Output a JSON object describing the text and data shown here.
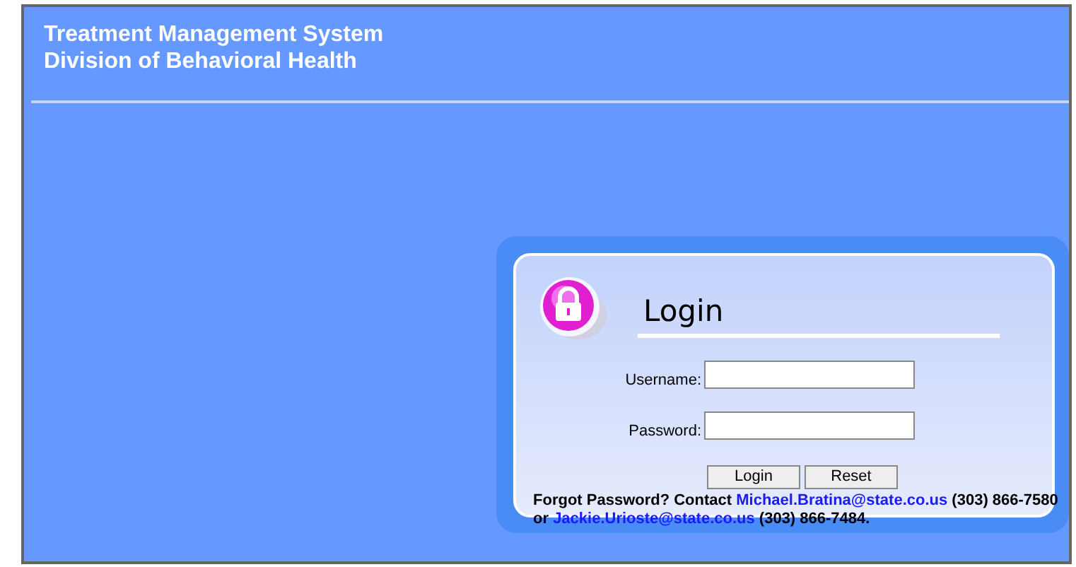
{
  "header": {
    "title": "Treatment Management System",
    "subtitle": "Division of Behavioral Health"
  },
  "login": {
    "title": "Login",
    "fields": [
      {
        "label": "Username:"
      },
      {
        "label": "Password:"
      }
    ],
    "buttons": [
      "Login",
      "Reset"
    ],
    "help": [
      {
        "kind": "text",
        "text": "Forgot Password? Contact "
      },
      {
        "kind": "link",
        "text": "Michael.Bratina@state.co.us"
      },
      {
        "kind": "text",
        "text": " (303) 866-7580 or "
      },
      {
        "kind": "link",
        "text": "Jackie.Urioste@state.co.us"
      },
      {
        "kind": "text",
        "text": " (303) 866-7484."
      }
    ]
  }
}
